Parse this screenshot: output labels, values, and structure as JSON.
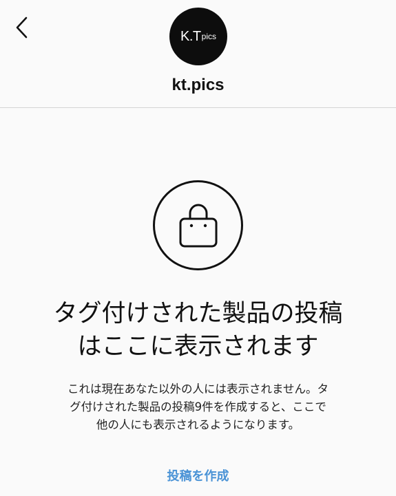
{
  "header": {
    "avatar_main": "K.T",
    "avatar_sub": "pics",
    "username": "kt.pics"
  },
  "empty_state": {
    "title_line1": "タグ付けされた製品の投稿",
    "title_line2": "はここに表示されます",
    "desc_line1": "これは現在あなた以外の人には表示されません。タ",
    "desc_line2": "グ付けされた製品の投稿9件を作成すると、ここで",
    "desc_line3": "他の人にも表示されるようになります。",
    "create_post_label": "投稿を作成"
  },
  "colors": {
    "link": "#4a93d6",
    "divider": "#d4d4d4",
    "background": "#fafafa"
  },
  "icons": {
    "back": "chevron-left-icon",
    "bag": "shopping-bag-icon"
  }
}
